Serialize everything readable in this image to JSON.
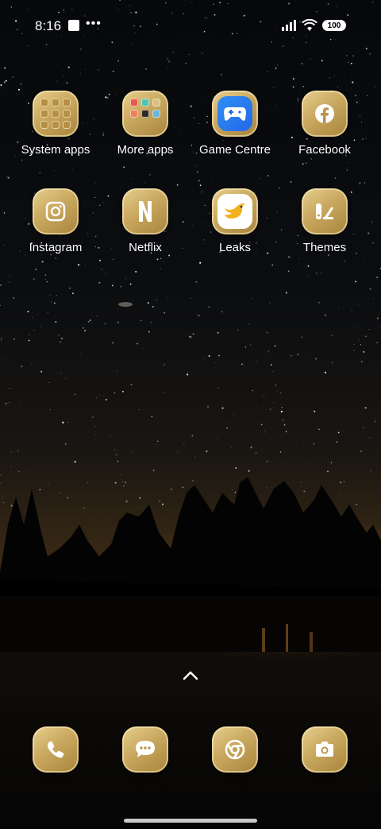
{
  "status_bar": {
    "time": "8:16",
    "battery": "100",
    "icons": [
      "notification-square-icon",
      "more-dots-icon",
      "signal-icon",
      "wifi-icon",
      "battery-icon"
    ]
  },
  "apps_row1": [
    {
      "label": "System apps",
      "icon": "folder-icon"
    },
    {
      "label": "More apps",
      "icon": "folder-icon"
    },
    {
      "label": "Game Centre",
      "icon": "gamepad-icon"
    },
    {
      "label": "Facebook",
      "icon": "facebook-icon"
    }
  ],
  "apps_row2": [
    {
      "label": "Instagram",
      "icon": "instagram-icon"
    },
    {
      "label": "Netflix",
      "icon": "netflix-icon"
    },
    {
      "label": "Leaks",
      "icon": "bird-icon"
    },
    {
      "label": "Themes",
      "icon": "themes-brush-icon"
    }
  ],
  "dock": [
    {
      "icon": "phone-icon"
    },
    {
      "icon": "messages-icon"
    },
    {
      "icon": "chrome-icon"
    },
    {
      "icon": "camera-icon"
    }
  ],
  "colors": {
    "gold_light": "#e6cf8e",
    "gold_dark": "#a8843c",
    "icon_white": "#ffffff"
  }
}
